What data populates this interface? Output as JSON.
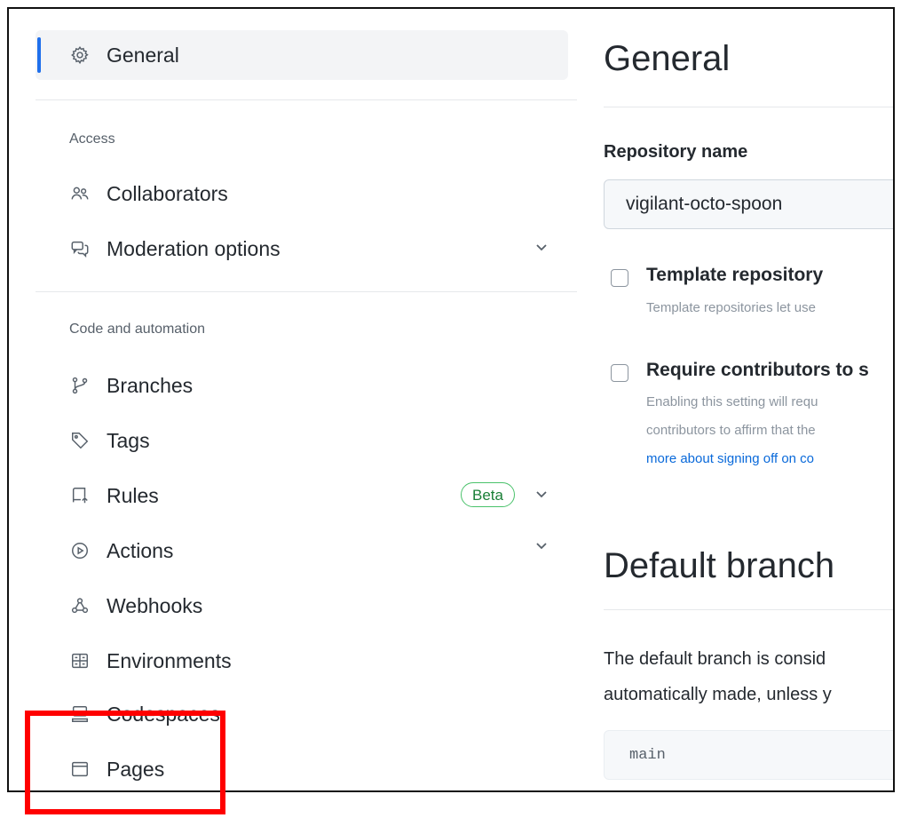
{
  "sidebar": {
    "general": "General",
    "access_heading": "Access",
    "collaborators": "Collaborators",
    "moderation": "Moderation options",
    "code_heading": "Code and automation",
    "branches": "Branches",
    "tags": "Tags",
    "rules": "Rules",
    "rules_badge": "Beta",
    "actions": "Actions",
    "webhooks": "Webhooks",
    "environments": "Environments",
    "codespaces": "Codespaces",
    "pages": "Pages"
  },
  "main": {
    "title": "General",
    "repo_name_label": "Repository name",
    "repo_name_value": "vigilant-octo-spoon",
    "template": {
      "title": "Template repository",
      "desc": "Template repositories let use"
    },
    "signoff": {
      "title": "Require contributors to s",
      "desc1": "Enabling this setting will requ",
      "desc2": "contributors to affirm that the",
      "desc3": "more about signing off on co"
    },
    "default_branch": {
      "title": "Default branch",
      "line1": "The default branch is consid",
      "line2": "automatically made, unless y",
      "branch": "main"
    }
  },
  "colors": {
    "accent": "#1f6feb",
    "highlight": "#ff0000",
    "badge": "#1a7f37"
  }
}
